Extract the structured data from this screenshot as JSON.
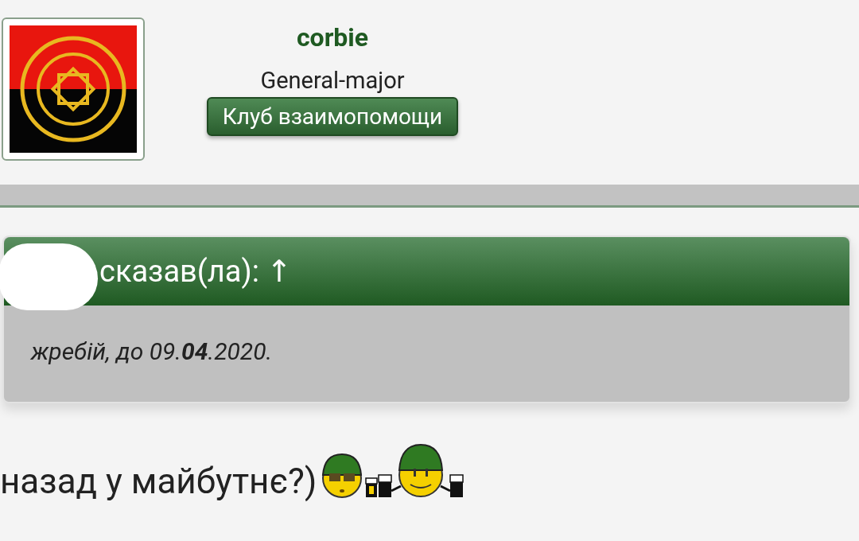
{
  "user": {
    "name": "corbie",
    "rank": "General-major",
    "group_button": "Клуб взаимопомощи"
  },
  "quote": {
    "header": "сказав(ла): ↑",
    "author_hidden": true,
    "text": "жребій, до 09.**04**.2020."
  },
  "post": {
    "text": "назад у майбутнє?)"
  }
}
